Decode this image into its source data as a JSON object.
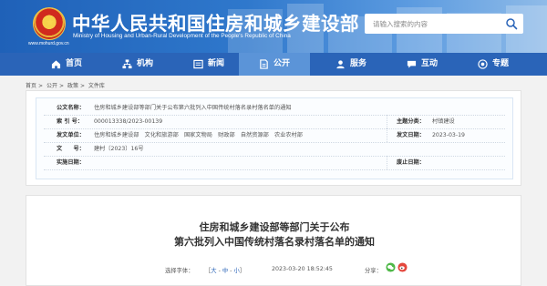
{
  "header": {
    "title": "中华人民共和国住房和城乡建设部",
    "subtitle": "Ministry of Housing and Urban-Rural Development of the People's Republic of China",
    "domain": "www.mohurd.gov.cn",
    "search_placeholder": "请输入搜索的内容",
    "brand_color": "#2a64b8"
  },
  "nav": {
    "items": [
      {
        "label": "首页",
        "icon": "home-icon"
      },
      {
        "label": "机构",
        "icon": "org-chart-icon"
      },
      {
        "label": "新闻",
        "icon": "news-icon"
      },
      {
        "label": "公开",
        "icon": "document-icon",
        "active": true
      },
      {
        "label": "服务",
        "icon": "service-icon"
      },
      {
        "label": "互动",
        "icon": "chat-icon"
      },
      {
        "label": "专题",
        "icon": "topic-icon"
      }
    ]
  },
  "breadcrumb": [
    "首页",
    "公开",
    "政策",
    "文件库"
  ],
  "info": {
    "publisher_label": "公文名称：",
    "publisher_value": "住房和城乡建设部等部门关于公布第六批列入中国传统村落名录村落名单的通知",
    "index_label": "索 引 号：",
    "index_value": "000013338/2023-00139",
    "category_label": "主题分类：",
    "category_value": "村镇建设",
    "issuer_label": "发文单位：",
    "issuer_value": "住房和城乡建设部　文化和旅游部　国家文物局　财政部　自然资源部　农业农村部",
    "date_label": "发文日期：",
    "date_value": "2023-03-19",
    "docno_label": "文　　号：",
    "docno_value": "建村〔2023〕16号",
    "effective_label": "实施日期：",
    "effective_value": "",
    "repeal_label": "废止日期：",
    "repeal_value": ""
  },
  "article": {
    "title_line1": "住房和城乡建设部等部门关于公布",
    "title_line2": "第六批列入中国传统村落名录村落名单的通知",
    "font_label": "选择字体：",
    "font_open": "［",
    "font_large": "大",
    "font_medium": "中",
    "font_small": "小",
    "font_sep": " - ",
    "font_close": "］",
    "datetime": "2023-03-20 18:52:45",
    "share_label": "分享："
  }
}
